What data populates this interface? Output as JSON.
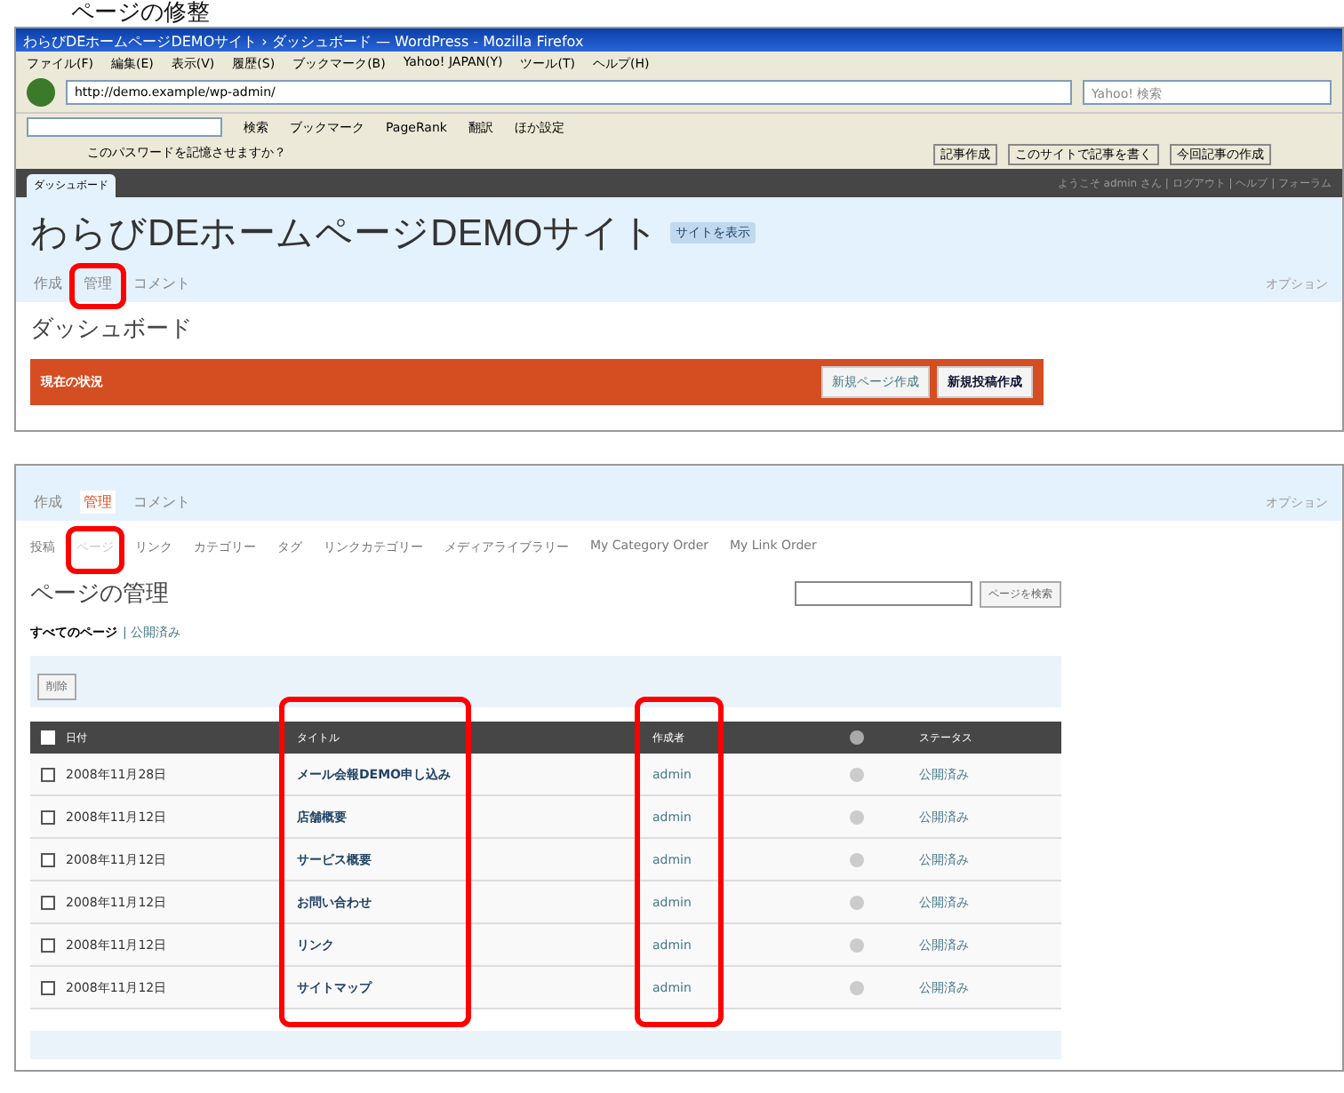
{
  "heading": "ページの修整",
  "shot1": {
    "window_title": "わらびDEホームページDEMOサイト › ダッシュボード — WordPress - Mozilla Firefox",
    "menu": [
      "ファイル(F)",
      "編集(E)",
      "表示(V)",
      "履歴(S)",
      "ブックマーク(B)",
      "Yahoo! JAPAN(Y)",
      "ツール(T)",
      "ヘルプ(H)"
    ],
    "url": "http://demo.example/wp-admin/",
    "search_placeholder": "Yahoo! 検索",
    "toolbar": [
      "検索",
      "ブックマーク",
      "PageRank",
      "翻訳",
      "ほか設定"
    ],
    "password_note": "このパスワードを記憶させますか？",
    "top_links": [
      "記事作成",
      "このサイトで記事を書く",
      "今回記事の作成"
    ],
    "wp_tab": "ダッシュボード",
    "howdy": "ようこそ admin さん | ログアウト | ヘルプ | フォーラム",
    "blog_title": "わらびDEホームページDEMOサイト",
    "view_site": "サイトを表示",
    "nav": [
      {
        "label": "作成",
        "selected": false,
        "annotated": false
      },
      {
        "label": "管理",
        "selected": false,
        "annotated": true
      },
      {
        "label": "コメント",
        "selected": false,
        "annotated": false
      }
    ],
    "options": "オプション",
    "page_heading": "ダッシュボード",
    "status_label": "現在の状況",
    "buttons": [
      {
        "label": "新規ページ作成",
        "primary": false
      },
      {
        "label": "新規投稿作成",
        "primary": true
      }
    ]
  },
  "shot2": {
    "nav": [
      {
        "label": "作成",
        "selected": false
      },
      {
        "label": "管理",
        "selected": true
      },
      {
        "label": "コメント",
        "selected": false
      }
    ],
    "options": "オプション",
    "subnav": [
      {
        "label": "投稿",
        "selected": false,
        "annotated": false
      },
      {
        "label": "ページ",
        "selected": true,
        "annotated": true
      },
      {
        "label": "リンク",
        "selected": false,
        "annotated": false
      },
      {
        "label": "カテゴリー",
        "selected": false,
        "annotated": false
      },
      {
        "label": "タグ",
        "selected": false,
        "annotated": false
      },
      {
        "label": "リンクカテゴリー",
        "selected": false,
        "annotated": false
      },
      {
        "label": "メディアライブラリー",
        "selected": false,
        "annotated": false
      },
      {
        "label": "My Category Order",
        "selected": false,
        "annotated": false
      },
      {
        "label": "My Link Order",
        "selected": false,
        "annotated": false
      }
    ],
    "page_heading": "ページの管理",
    "search_button": "ページを検索",
    "filter_all": "すべてのページ",
    "filter_published": "| 公開済み",
    "delete_button": "削除",
    "all_checked": false,
    "columns": [
      "日付",
      "タイトル",
      "作成者",
      "ステータス"
    ],
    "rows": [
      {
        "date": "2008年11月28日",
        "title": "メール会報DEMO申し込み",
        "author": "admin",
        "status": "公開済み",
        "checked": false
      },
      {
        "date": "2008年11月12日",
        "title": "店舗概要",
        "author": "admin",
        "status": "公開済み",
        "checked": false
      },
      {
        "date": "2008年11月12日",
        "title": "サービス概要",
        "author": "admin",
        "status": "公開済み",
        "checked": false
      },
      {
        "date": "2008年11月12日",
        "title": "お問い合わせ",
        "author": "admin",
        "status": "公開済み",
        "checked": false
      },
      {
        "date": "2008年11月12日",
        "title": "リンク",
        "author": "admin",
        "status": "公開済み",
        "checked": false
      },
      {
        "date": "2008年11月12日",
        "title": "サイトマップ",
        "author": "admin",
        "status": "公開済み",
        "checked": false
      }
    ]
  }
}
